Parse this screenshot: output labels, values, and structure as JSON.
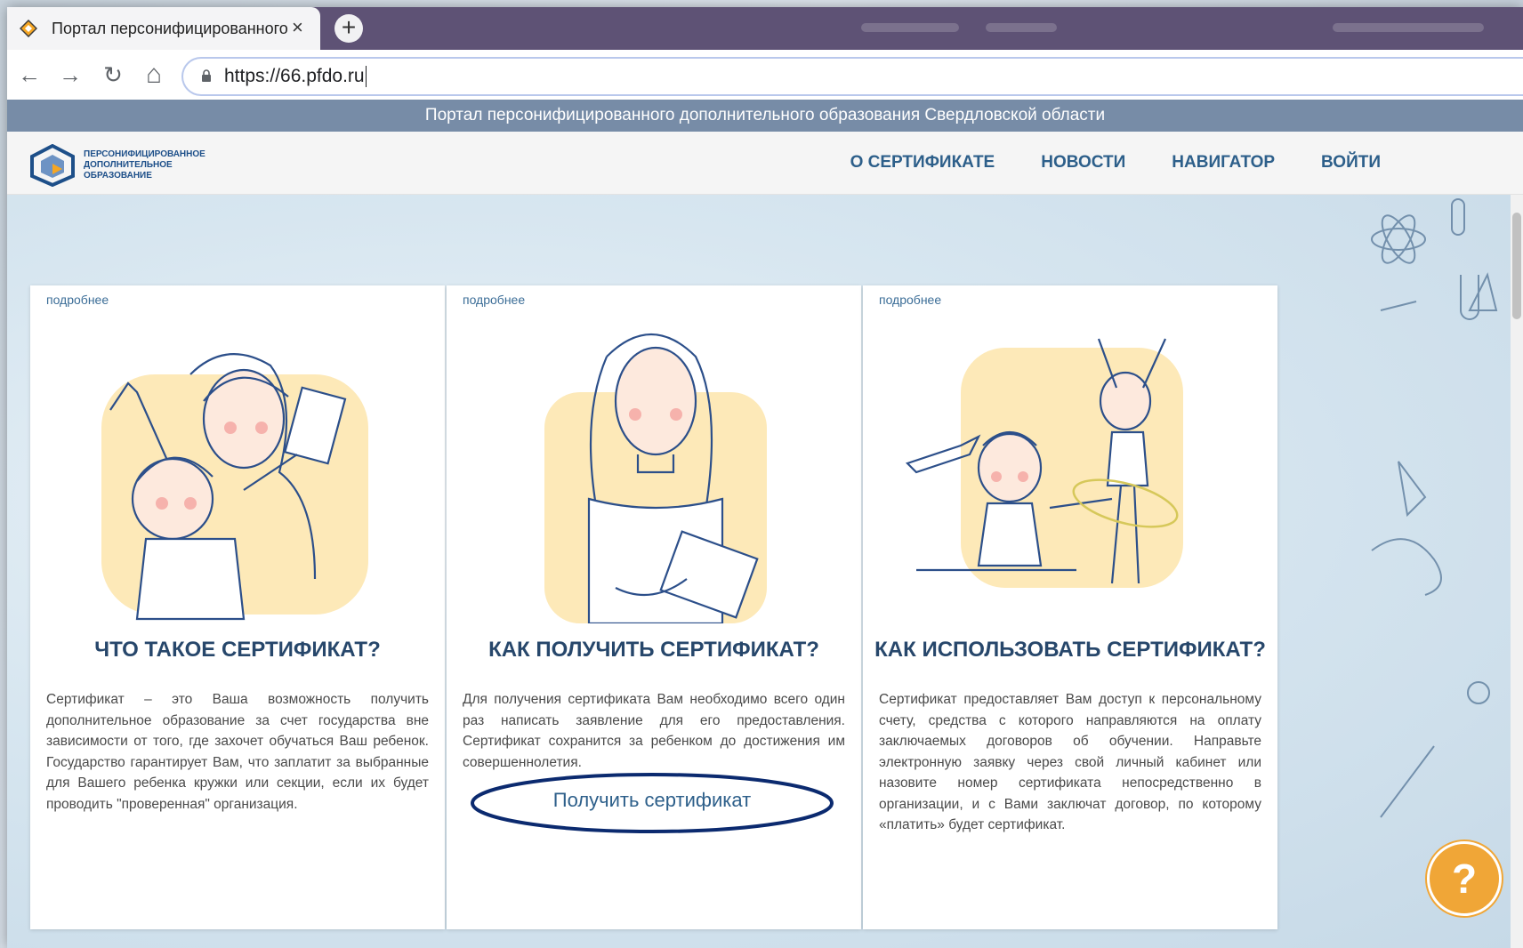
{
  "browser": {
    "tab_title": "Портал персонифицированного",
    "tab_close": "×",
    "new_tab": "+",
    "back": "←",
    "forward": "→",
    "reload": "↻",
    "home": "⌂",
    "url": "https://66.pfdo.ru"
  },
  "site": {
    "banner": "Портал персонифицированного дополнительного образования Свердловской области",
    "logo_lines": [
      "ПЕРСОНИФИЦИРОВАННОЕ",
      "ДОПОЛНИТЕЛЬНОЕ",
      "ОБРАЗОВАНИЕ"
    ],
    "nav": [
      "О СЕРТИФИКАТЕ",
      "НОВОСТИ",
      "НАВИГАТОР",
      "ВОЙТИ"
    ]
  },
  "cards": [
    {
      "more": "подробнее",
      "title": "ЧТО ТАКОЕ СЕРТИФИКАТ?",
      "text": "Сертификат – это Ваша возможность получить дополнительное образование за счет государства вне зависимости от того, где захочет обучаться Ваш ребенок. Государство гарантирует Вам, что заплатит за выбранные для Вашего ребенка кружки или секции, если их будет проводить \"проверенная\" организация."
    },
    {
      "more": "подробнее",
      "title": "КАК ПОЛУЧИТЬ СЕРТИФИКАТ?",
      "text": "Для получения сертификата Вам необходимо всего один раз написать заявление для его предоставления. Сертификат сохранится за ребенком до достижения им совершеннолетия.",
      "button": "Получить сертификат"
    },
    {
      "more": "подробнее",
      "title": "КАК ИСПОЛЬЗОВАТЬ СЕРТИФИКАТ?",
      "text": "Сертификат предоставляет Вам доступ к персональному счету, средства с которого направляются на оплату заключаемых договоров об обучении. Направьте электронную заявку через свой личный кабинет или назовите номер сертификата непосредственно в организации, и с Вами заключат договор, по которому «платить» будет сертификат."
    }
  ],
  "help": "?",
  "colors": {
    "tab_strip": "#5e5275",
    "banner": "#778ca7",
    "nav_text": "#2d5f8a",
    "annotation": "#0b2a6f",
    "help": "#f0a637"
  }
}
